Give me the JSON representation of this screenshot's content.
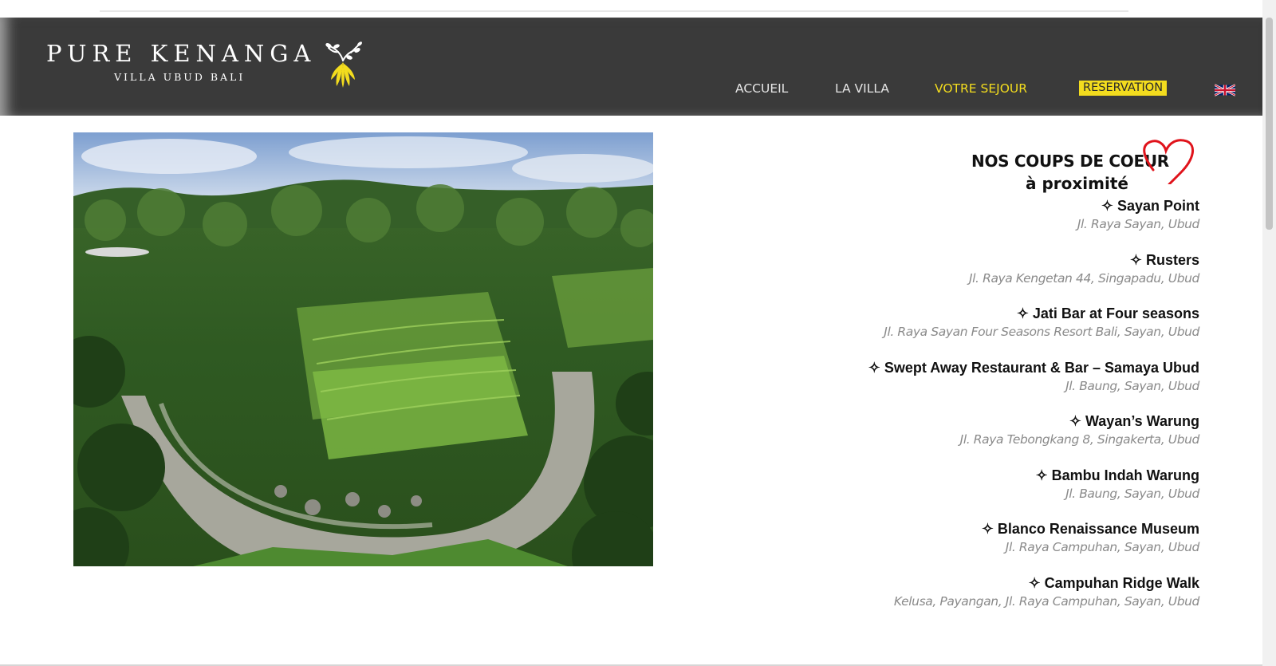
{
  "site": {
    "logo_title": "PURE KENANGA",
    "logo_subtitle": "VILLA UBUD BALI",
    "logo_icon": "kenanga-flower-icon"
  },
  "nav": {
    "items": [
      {
        "label": "ACCUEIL",
        "state": "normal"
      },
      {
        "label": "LA VILLA",
        "state": "normal"
      },
      {
        "label": "VOTRE SEJOUR",
        "state": "active"
      },
      {
        "label": "RESERVATION",
        "state": "highlighted"
      }
    ],
    "language_flag": "uk-flag-icon"
  },
  "colors": {
    "header_bg": "#3a3a3a",
    "accent_yellow": "#f3dc1e",
    "heart_red": "#e0131b"
  },
  "photo": {
    "subject": "rice terraces and river surrounded by palm trees"
  },
  "section": {
    "title_line1": "NOS COUPS DE COEUR",
    "title_line2": "à proximité",
    "decoration": "heart-icon"
  },
  "places": [
    {
      "name": "✧ Sayan Point",
      "address": "Jl. Raya Sayan, Ubud"
    },
    {
      "name": "✧ Rusters",
      "address": "Jl. Raya Kengetan 44, Singapadu, Ubud"
    },
    {
      "name": "✧ Jati Bar at Four seasons",
      "address": "Jl. Raya Sayan Four Seasons Resort Bali, Sayan, Ubud"
    },
    {
      "name": "✧ Swept Away Restaurant & Bar – Samaya Ubud",
      "address": "Jl. Baung, Sayan, Ubud"
    },
    {
      "name": "✧ Wayan’s Warung",
      "address": "Jl. Raya Tebongkang 8, Singakerta, Ubud"
    },
    {
      "name": "✧ Bambu Indah Warung",
      "address": "Jl. Baung, Sayan, Ubud"
    },
    {
      "name": "✧ Blanco Renaissance Museum",
      "address": "Jl. Raya Campuhan, Sayan, Ubud"
    },
    {
      "name": "✧ Campuhan Ridge Walk",
      "address": "Kelusa, Payangan, Jl. Raya Campuhan, Sayan, Ubud"
    }
  ]
}
